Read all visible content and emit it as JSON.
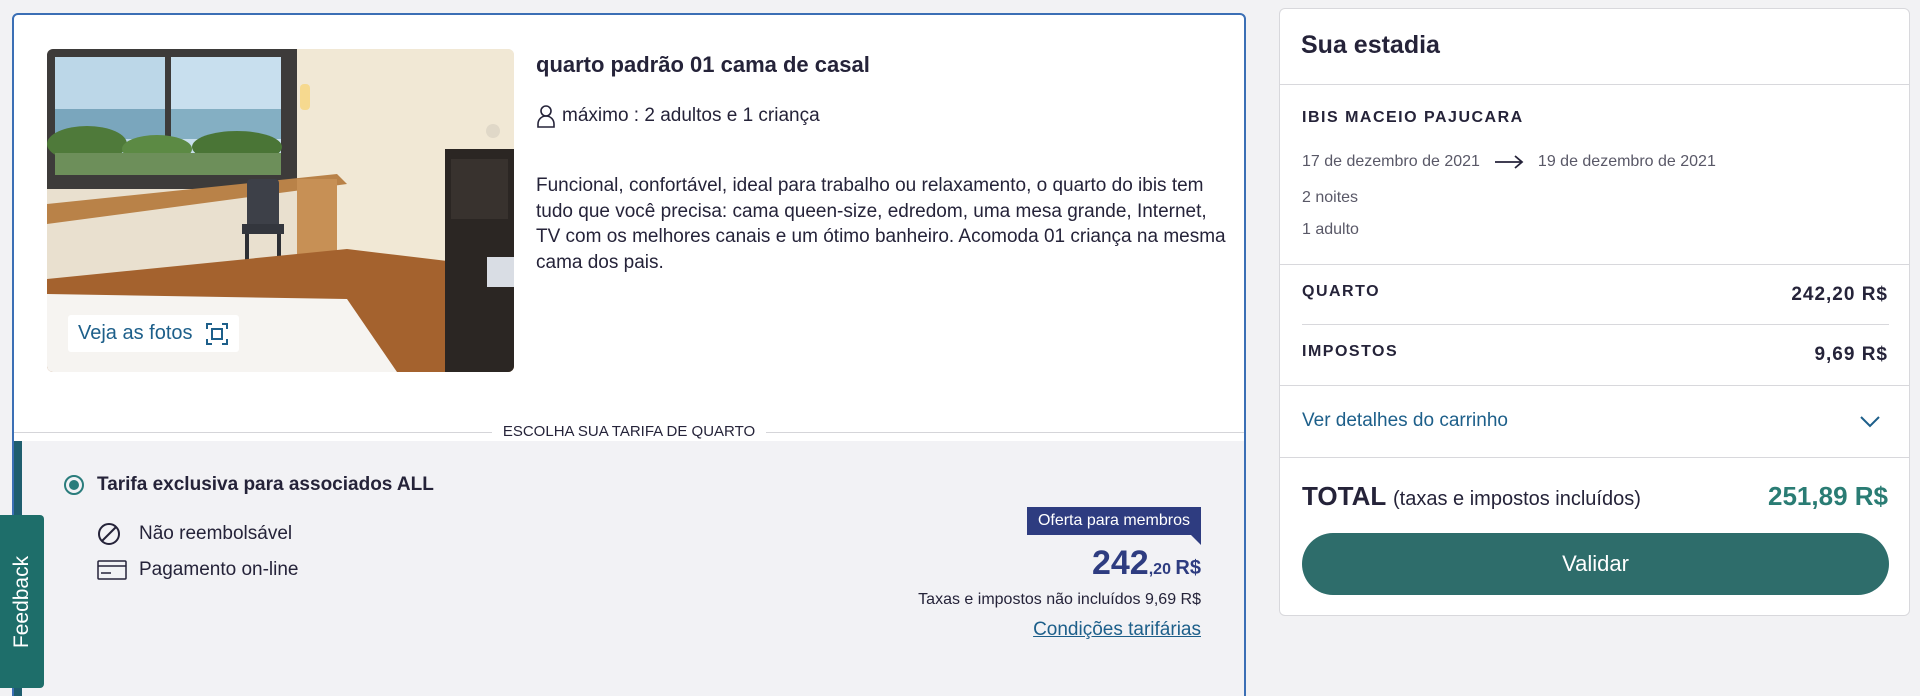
{
  "room": {
    "title": "quarto padrão 01 cama de casal",
    "capacity": "máximo : 2 adultos e 1 criança",
    "description": "Funcional, confortável, ideal para trabalho ou relaxamento, o quarto do ibis tem tudo que você precisa: cama queen-size, edredom, uma mesa grande, Internet, TV com os melhores canais e um ótimo banheiro. Acomoda 01 criança na mesma cama dos pais.",
    "photos_button": "Veja as fotos"
  },
  "rate_section": {
    "divider_label": "ESCOLHA SUA TARIFA DE QUARTO",
    "rate_name": "Tarifa exclusiva para associados ALL",
    "conditions": [
      "Não reembolsável",
      "Pagamento on-line"
    ],
    "offer_badge": "Oferta para membros",
    "price_int": "242",
    "price_dec": ",20",
    "price_currency": "R$",
    "tax_note": "Taxas e impostos não incluídos 9,69 R$",
    "tariff_link": "Condições tarifárias"
  },
  "feedback": {
    "label": "Feedback"
  },
  "summary": {
    "title": "Sua estadia",
    "hotel": "IBIS MACEIO PAJUCARA",
    "check_in": "17 de dezembro de 2021",
    "check_out": "19 de dezembro de 2021",
    "nights": "2 noites",
    "guests": "1 adulto",
    "lines": [
      {
        "label": "QUARTO",
        "value": "242,20 R$"
      },
      {
        "label": "IMPOSTOS",
        "value": "9,69 R$"
      }
    ],
    "cart_link": "Ver detalhes do carrinho",
    "total_label": "TOTAL",
    "total_sub": "(taxas e impostos incluídos)",
    "total_value": "251,89 R$",
    "validate_button": "Validar"
  },
  "colors": {
    "accent_teal": "#2e6d6b",
    "member_blue": "#2e3c80",
    "link_blue": "#1d5f8a",
    "card_border": "#3b6fb5"
  }
}
